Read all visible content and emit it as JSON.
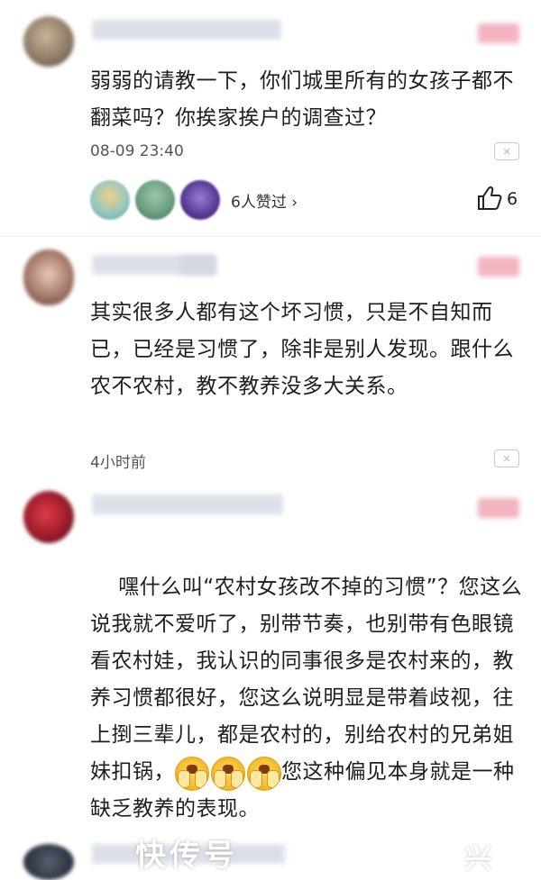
{
  "comments": [
    {
      "text": "弱弱的请教一下，你们城里所有的女孩子都不翻菜吗？你挨家挨户的调查过？",
      "time": "08-09 23:40",
      "report_icon": "×",
      "likers_text": "6人赞过 ›",
      "like_count": "6"
    },
    {
      "text": "其实很多人都有这个坏习惯，只是不自知而已，已经是习惯了，除非是别人发现。跟什么农不农村，教不教养没多大关系。",
      "time": "4小时前",
      "report_icon": "×"
    },
    {
      "text": "嘿什么叫“农村女孩改不掉的习惯”？您这么说我就不爱听了，别带节奏，也别带有色眼镜看农村娃，我认识的同事很多是农村来的，教养习惯都很好，您这么说明显是带着歧视，往上捯三辈儿，都是农村的，别给农村的兄弟姐妹扣锅，",
      "text_after_emoji": "您这种偏见本身就是一种缺乏教养的表现。"
    }
  ],
  "icons": {
    "report": "report-icon",
    "thumb": "thumbs-up-icon",
    "emoji": "praying-face-emoji"
  },
  "watermark": "快传号",
  "watermark_partial": "兴"
}
